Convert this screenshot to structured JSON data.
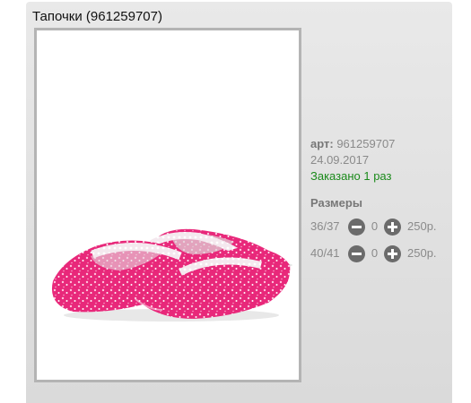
{
  "product": {
    "title": "Тапочки (961259707)",
    "image_alt": "pink-slippers-photo"
  },
  "info": {
    "article_label": "арт:",
    "article_value": "961259707",
    "date": "24.09.2017",
    "ordered": "Заказано 1 раз",
    "sizes_title": "Размеры"
  },
  "sizes": [
    {
      "size": "36/37",
      "qty": "0",
      "price": "250р."
    },
    {
      "size": "40/41",
      "qty": "0",
      "price": "250р."
    }
  ],
  "colors": {
    "ordered_text": "#1a8a1a",
    "slipper_pink": "#e8287a",
    "button_gray": "#6b6b6b"
  }
}
